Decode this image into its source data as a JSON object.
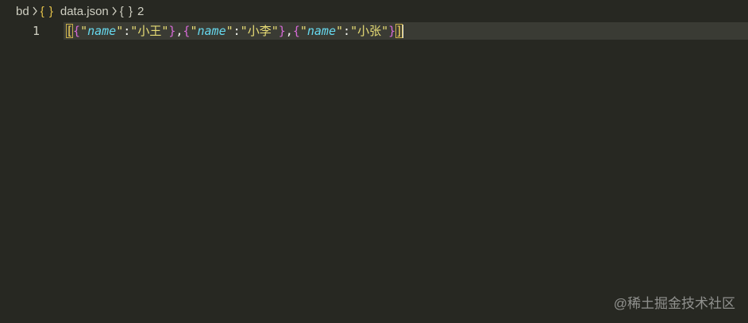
{
  "breadcrumb": {
    "folder": "bd",
    "file_icon": "{ }",
    "file": "data.json",
    "object_icon": "{ }",
    "object_count": "2"
  },
  "editor": {
    "line_number": "1",
    "tokens": {
      "open_array": "[",
      "open_obj": "{",
      "close_obj": "}",
      "quote": "\"",
      "key": "name",
      "colon": ":",
      "comma": ",",
      "close_array": "]"
    },
    "values": [
      "小王",
      "小李",
      "小张"
    ]
  },
  "watermark": "@稀土掘金技术社区",
  "colors": {
    "background": "#272822",
    "current_line": "#3a3b34",
    "key": "#66d9ef",
    "string": "#e6db74",
    "bracket_outer": "#f4d35e",
    "bracket_inner": "#d66ad6"
  }
}
